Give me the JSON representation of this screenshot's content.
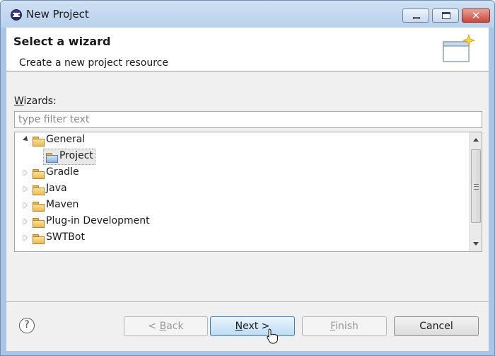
{
  "window": {
    "title": "New Project",
    "controls": {
      "minimize": "minimize",
      "maximize": "maximize",
      "close": "✕"
    }
  },
  "banner": {
    "title": "Select a wizard",
    "description": "Create a new project resource"
  },
  "wizards": {
    "label_mnemonic": "W",
    "label_rest": "izards:",
    "filter_placeholder": "type filter text",
    "filter_value": ""
  },
  "tree": {
    "items": [
      {
        "label": "General",
        "expanded": true,
        "icon": "folder-icon"
      },
      {
        "label": "Project",
        "child": true,
        "selected": true,
        "icon": "project-icon"
      },
      {
        "label": "Gradle",
        "expanded": false,
        "icon": "folder-icon"
      },
      {
        "label": "Java",
        "expanded": false,
        "icon": "folder-icon"
      },
      {
        "label": "Maven",
        "expanded": false,
        "icon": "folder-icon"
      },
      {
        "label": "Plug-in Development",
        "expanded": false,
        "icon": "folder-icon"
      },
      {
        "label": "SWTBot",
        "expanded": false,
        "icon": "folder-icon"
      }
    ]
  },
  "footer": {
    "help": "?",
    "back": {
      "prefix": "< ",
      "mnemonic": "B",
      "rest": "ack",
      "enabled": false
    },
    "next": {
      "mnemonic": "N",
      "rest": "ext >",
      "enabled": true
    },
    "finish": {
      "mnemonic": "F",
      "rest": "inish",
      "enabled": false
    },
    "cancel": "Cancel"
  },
  "colors": {
    "titlebar": "#b9d1ec",
    "dialog_bg": "#f0f0f0",
    "next_button": "#bcdcf4",
    "close_button": "#c8493a"
  }
}
